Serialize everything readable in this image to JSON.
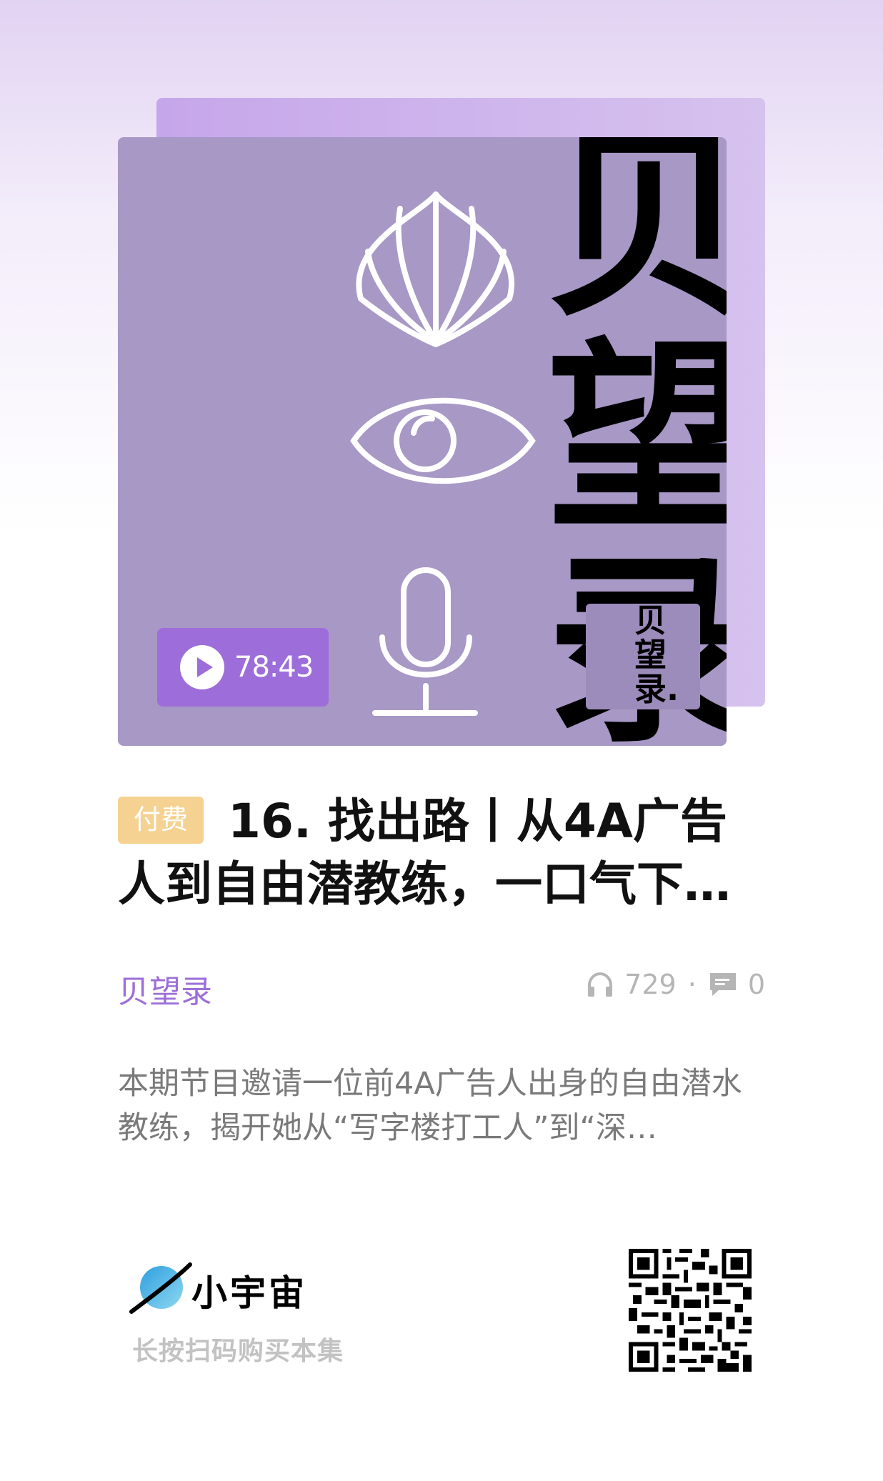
{
  "cover": {
    "big_text": "贝\n望\n录.",
    "mini_text": "贝\n望\n录.",
    "duration": "78:43"
  },
  "episode": {
    "badge": "付费",
    "title": "16. 找出路丨从4A广告人到自由潜教练，一口气下…"
  },
  "meta": {
    "album": "贝望录",
    "listens": "729",
    "dot": "·",
    "comments": "0"
  },
  "description": "本期节目邀请一位前4A广告人出身的自由潜水教练，揭开她从“写字楼打工人”到“深…",
  "brand": {
    "name": "小宇宙",
    "hint": "长按扫码购买本集"
  },
  "colors": {
    "accent": "#9d6ed9",
    "badge": "#f5d291",
    "cover_bg": "#a798c6"
  }
}
